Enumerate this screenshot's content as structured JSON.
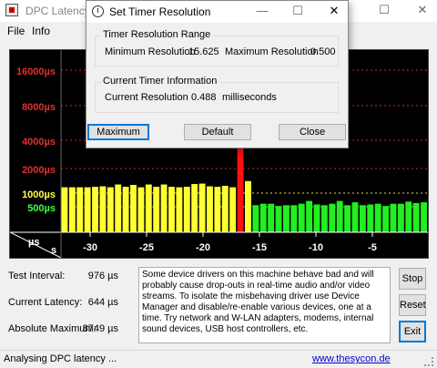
{
  "window": {
    "title": "DPC Latency Checker",
    "minimize_icon": "minimize-icon",
    "maximize_icon": "maximize-icon",
    "close_icon": "close-icon"
  },
  "menu": {
    "items": [
      "File",
      "Info"
    ]
  },
  "chart_data": {
    "type": "bar",
    "ylabel": "µs",
    "xlabel": "s",
    "y_ticks": [
      {
        "label": "16000µs",
        "color": "#e03030"
      },
      {
        "label": "8000µs",
        "color": "#e03030"
      },
      {
        "label": "4000µs",
        "color": "#e03030"
      },
      {
        "label": "2000µs",
        "color": "#e03030"
      },
      {
        "label": "1000µs",
        "color": "#ffff40"
      },
      {
        "label": "500µs",
        "color": "#40ff40"
      }
    ],
    "x_ticks": [
      "-30",
      "-25",
      "-20",
      "-15",
      "-10",
      "-5"
    ],
    "values": [
      820,
      820,
      820,
      820,
      830,
      840,
      820,
      880,
      830,
      870,
      820,
      880,
      830,
      880,
      830,
      820,
      830,
      890,
      900,
      840,
      830,
      850,
      820,
      8700,
      960,
      520,
      540,
      540,
      510,
      520,
      520,
      540,
      580,
      530,
      520,
      540,
      580,
      520,
      560,
      520,
      530,
      540,
      510,
      540,
      540,
      570,
      550,
      560
    ],
    "colors": {
      "green": "#22ee22",
      "yellow": "#ffff33",
      "red": "#ff1010"
    }
  },
  "stats": {
    "interval_label": "Test Interval:",
    "interval_value": "976 µs",
    "latency_label": "Current Latency:",
    "latency_value": "644 µs",
    "max_label": "Absolute Maximum:",
    "max_value": "8749 µs"
  },
  "info_text": "Some device drivers on this machine behave bad and will probably cause drop-outs in real-time audio and/or video streams. To isolate the misbehaving driver use Device Manager and disable/re-enable various devices, one at a time. Try network and W-LAN adapters, modems, internal sound devices, USB host controllers, etc.",
  "buttons": {
    "stop": "Stop",
    "reset": "Reset",
    "exit": "Exit"
  },
  "status": {
    "text": "Analysing DPC latency ...",
    "link": "www.thesycon.de"
  },
  "dialog": {
    "title": "Set Timer Resolution",
    "range_group": "Timer Resolution Range",
    "min_label": "Minimum Resolution",
    "min_value": "15.625",
    "max_label": "Maximum Resolution",
    "max_value": "0.500",
    "current_group": "Current Timer Information",
    "current_label": "Current Resolution",
    "current_value": "0.488",
    "current_unit": "milliseconds",
    "btn_maximum": "Maximum",
    "btn_default": "Default",
    "btn_close": "Close"
  }
}
